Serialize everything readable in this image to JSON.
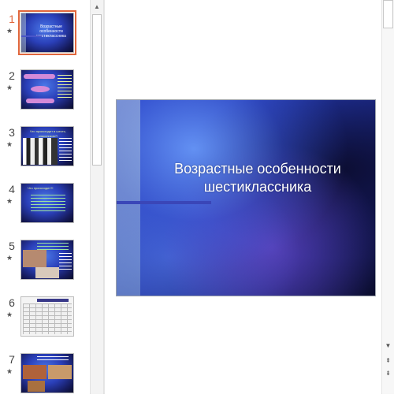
{
  "thumbnails": [
    {
      "num": "1",
      "star": "★",
      "mini_title": "Возрастные особенности шестиклассника"
    },
    {
      "num": "2",
      "star": "★"
    },
    {
      "num": "3",
      "star": "★",
      "mini_title": "Что происходит в шесть-классников?!"
    },
    {
      "num": "4",
      "star": "★",
      "mini_title": "Что происходит?!"
    },
    {
      "num": "5",
      "star": "★"
    },
    {
      "num": "6",
      "star": "★"
    },
    {
      "num": "7",
      "star": "★"
    }
  ],
  "slide": {
    "title": "Возрастные особенности шестиклассника"
  },
  "scrollbar": {
    "up_arrow": "▲",
    "down_arrow": "▼",
    "prev_slide": "⇞",
    "next_slide": "⇟"
  },
  "colors": {
    "selected_border": "#e0663c",
    "slide_blue": "#2236a8"
  }
}
